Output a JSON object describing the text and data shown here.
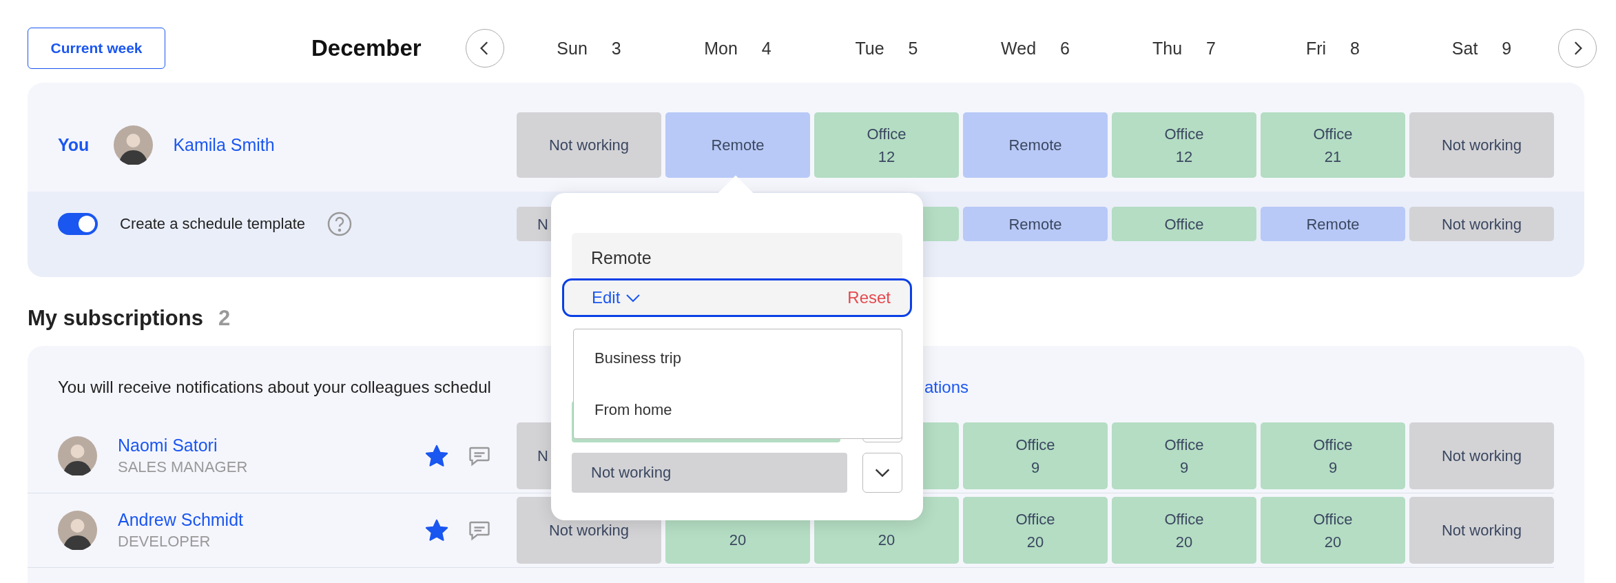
{
  "toolbar": {
    "current_week": "Current week",
    "month": "December"
  },
  "days": [
    {
      "name": "Sun",
      "date": "3"
    },
    {
      "name": "Mon",
      "date": "4"
    },
    {
      "name": "Tue",
      "date": "5"
    },
    {
      "name": "Wed",
      "date": "6"
    },
    {
      "name": "Thu",
      "date": "7"
    },
    {
      "name": "Fri",
      "date": "8"
    },
    {
      "name": "Sat",
      "date": "9"
    }
  ],
  "me": {
    "label": "You",
    "name": "Kamila Smith",
    "cells": [
      {
        "kind": "full",
        "color": "#d3d3d6",
        "lines": [
          "Not working"
        ]
      },
      {
        "kind": "full",
        "color": "#b8c9f7",
        "lines": [
          "Remote"
        ],
        "selected": true
      },
      {
        "kind": "full",
        "color": "#b4ddc3",
        "lines": [
          "Office",
          "12"
        ]
      },
      {
        "kind": "full",
        "color": "#b8c9f7",
        "lines": [
          "Remote"
        ]
      },
      {
        "kind": "full",
        "color": "#b4ddc3",
        "lines": [
          "Office",
          "12"
        ]
      },
      {
        "kind": "full",
        "color": "#b4ddc3",
        "lines": [
          "Office",
          "21"
        ]
      },
      {
        "kind": "full",
        "color": "#d3d3d6",
        "lines": [
          "Not working"
        ]
      }
    ]
  },
  "template": {
    "on": true,
    "label": "Create a schedule template",
    "cells": [
      {
        "kind": "cut-right",
        "color": "#d3d3d6",
        "lines": [
          "N"
        ]
      },
      {
        "kind": "hidden"
      },
      {
        "kind": "full",
        "color": "#b4ddc3"
      },
      {
        "kind": "full",
        "color": "#b8c9f7",
        "lines": [
          "Remote"
        ]
      },
      {
        "kind": "full",
        "color": "#b4ddc3",
        "lines": [
          "Office"
        ]
      },
      {
        "kind": "full",
        "color": "#b8c9f7",
        "lines": [
          "Remote"
        ]
      },
      {
        "kind": "full",
        "color": "#d3d3d6",
        "lines": [
          "Not working"
        ]
      }
    ]
  },
  "subscriptions": {
    "title": "My subscriptions",
    "count": "2",
    "notice": "You will receive notifications about your colleagues schedul",
    "notice_link": "ations",
    "people": [
      {
        "name": "Naomi Satori",
        "role": "SALES MANAGER",
        "starred": true,
        "cells": [
          {
            "kind": "cut-right",
            "color": "#d3d3d6",
            "lines": [
              "N"
            ]
          },
          {
            "kind": "hidden"
          },
          {
            "kind": "full",
            "color": "#b4ddc3"
          },
          {
            "kind": "full",
            "color": "#b4ddc3",
            "lines": [
              "Office",
              "9"
            ]
          },
          {
            "kind": "full",
            "color": "#b4ddc3",
            "lines": [
              "Office",
              "9"
            ]
          },
          {
            "kind": "full",
            "color": "#b4ddc3",
            "lines": [
              "Office",
              "9"
            ]
          },
          {
            "kind": "full",
            "color": "#d3d3d6",
            "lines": [
              "Not working"
            ]
          }
        ]
      },
      {
        "name": "Andrew Schmidt",
        "role": "DEVELOPER",
        "starred": true,
        "cells": [
          {
            "kind": "full",
            "color": "#d3d3d6",
            "lines": [
              "Not working"
            ]
          },
          {
            "kind": "cut-top",
            "color": "#b4ddc3",
            "lines": [
              "20"
            ]
          },
          {
            "kind": "cut-top",
            "color": "#b4ddc3",
            "lines": [
              "20"
            ]
          },
          {
            "kind": "full",
            "color": "#b4ddc3",
            "lines": [
              "Office",
              "20"
            ]
          },
          {
            "kind": "full",
            "color": "#b4ddc3",
            "lines": [
              "Office",
              "20"
            ]
          },
          {
            "kind": "full",
            "color": "#b4ddc3",
            "lines": [
              "Office",
              "20"
            ]
          },
          {
            "kind": "full",
            "color": "#d3d3d6",
            "lines": [
              "Not working"
            ]
          }
        ]
      }
    ]
  },
  "popover": {
    "status": "Remote",
    "edit": "Edit",
    "reset": "Reset",
    "options": [
      "Business trip",
      "From home"
    ],
    "select_value": "Not working"
  }
}
